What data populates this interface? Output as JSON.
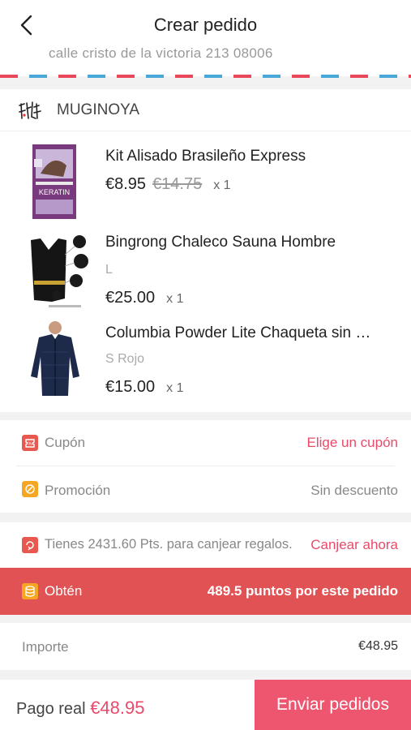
{
  "header": {
    "title": "Crear pedido",
    "back_icon": "chevron-left-icon"
  },
  "address": {
    "line": "calle cristo de la victoria 213 08006"
  },
  "shop": {
    "name": "MUGINOYA",
    "logo_text": "MUGINOYA logo"
  },
  "products": [
    {
      "name": "Kit Alisado Brasileño Express",
      "variant": "",
      "price": "€8.95",
      "old_price": "€14.75",
      "qty": "x 1"
    },
    {
      "name": "Bingrong Chaleco Sauna Hombre",
      "variant": "L",
      "price": "€25.00",
      "old_price": "",
      "qty": "x 1"
    },
    {
      "name": "Columbia Powder Lite Chaqueta sin …",
      "variant": "S Rojo",
      "price": "€15.00",
      "old_price": "",
      "qty": "x 1"
    }
  ],
  "coupon": {
    "label": "Cupón",
    "value": "Elige un cupón"
  },
  "promotion": {
    "label": "Promoción",
    "value": "Sin descuento"
  },
  "points": {
    "text": "Tienes 2431.60 Pts. para canjear regalos.",
    "link": "Canjear ahora"
  },
  "earn": {
    "label": "Obtén",
    "value": "489.5 puntos por este pedido"
  },
  "amount": {
    "label": "Importe",
    "value": "€48.95"
  },
  "footer": {
    "pay_label": "Pago real",
    "pay_amount": "€48.95",
    "submit_label": "Enviar pedidos"
  },
  "colors": {
    "accent": "#ee5670",
    "earn_bg": "#e05254",
    "coupon_icon": "#e8584f",
    "promo_icon": "#f5a623"
  }
}
